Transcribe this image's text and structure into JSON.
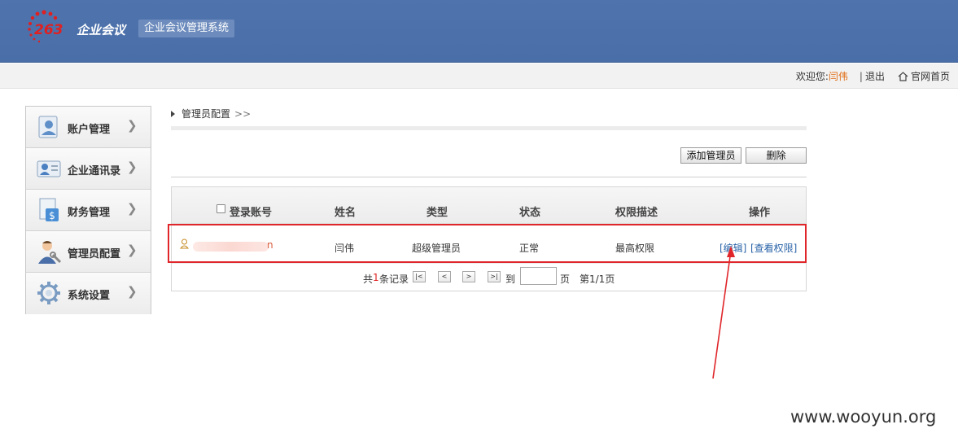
{
  "header": {
    "logo_number": "263",
    "logo_brand": "企业会议",
    "system_title": "企业会议管理系统"
  },
  "topbar": {
    "welcome": "欢迎您:",
    "user": "闫伟",
    "separator": "|",
    "logout": "退出",
    "home": "官网首页"
  },
  "sidebar": {
    "items": [
      {
        "label": "账户管理",
        "icon": "account-icon"
      },
      {
        "label": "企业通讯录",
        "icon": "contacts-icon"
      },
      {
        "label": "财务管理",
        "icon": "finance-icon"
      },
      {
        "label": "管理员配置",
        "icon": "admin-icon"
      },
      {
        "label": "系统设置",
        "icon": "settings-icon"
      }
    ]
  },
  "breadcrumb": {
    "current": "管理员配置",
    "sep": ">>"
  },
  "toolbar": {
    "add_label": "添加管理员",
    "delete_label": "删除"
  },
  "table": {
    "headers": [
      "登录账号",
      "姓名",
      "类型",
      "状态",
      "权限描述",
      "操作"
    ],
    "rows": [
      {
        "account_tail": "n",
        "name": "闫伟",
        "type": "超级管理员",
        "status": "正常",
        "permission": "最高权限",
        "op_edit": "[编辑]",
        "op_view": "[查看权限]"
      }
    ]
  },
  "pager": {
    "total_prefix": "共",
    "total_count": "1",
    "total_suffix": "条记录",
    "first": "|<",
    "prev": "<",
    "next": ">",
    "last": ">|",
    "goto": "到",
    "page_unit": "页",
    "page_info": "第1/1页"
  },
  "watermark": "www.wooyun.org",
  "colors": {
    "header_bg": "#4a6ea8",
    "user_name": "#e06a10",
    "link": "#2a64a8",
    "highlight": "#e0262a"
  }
}
